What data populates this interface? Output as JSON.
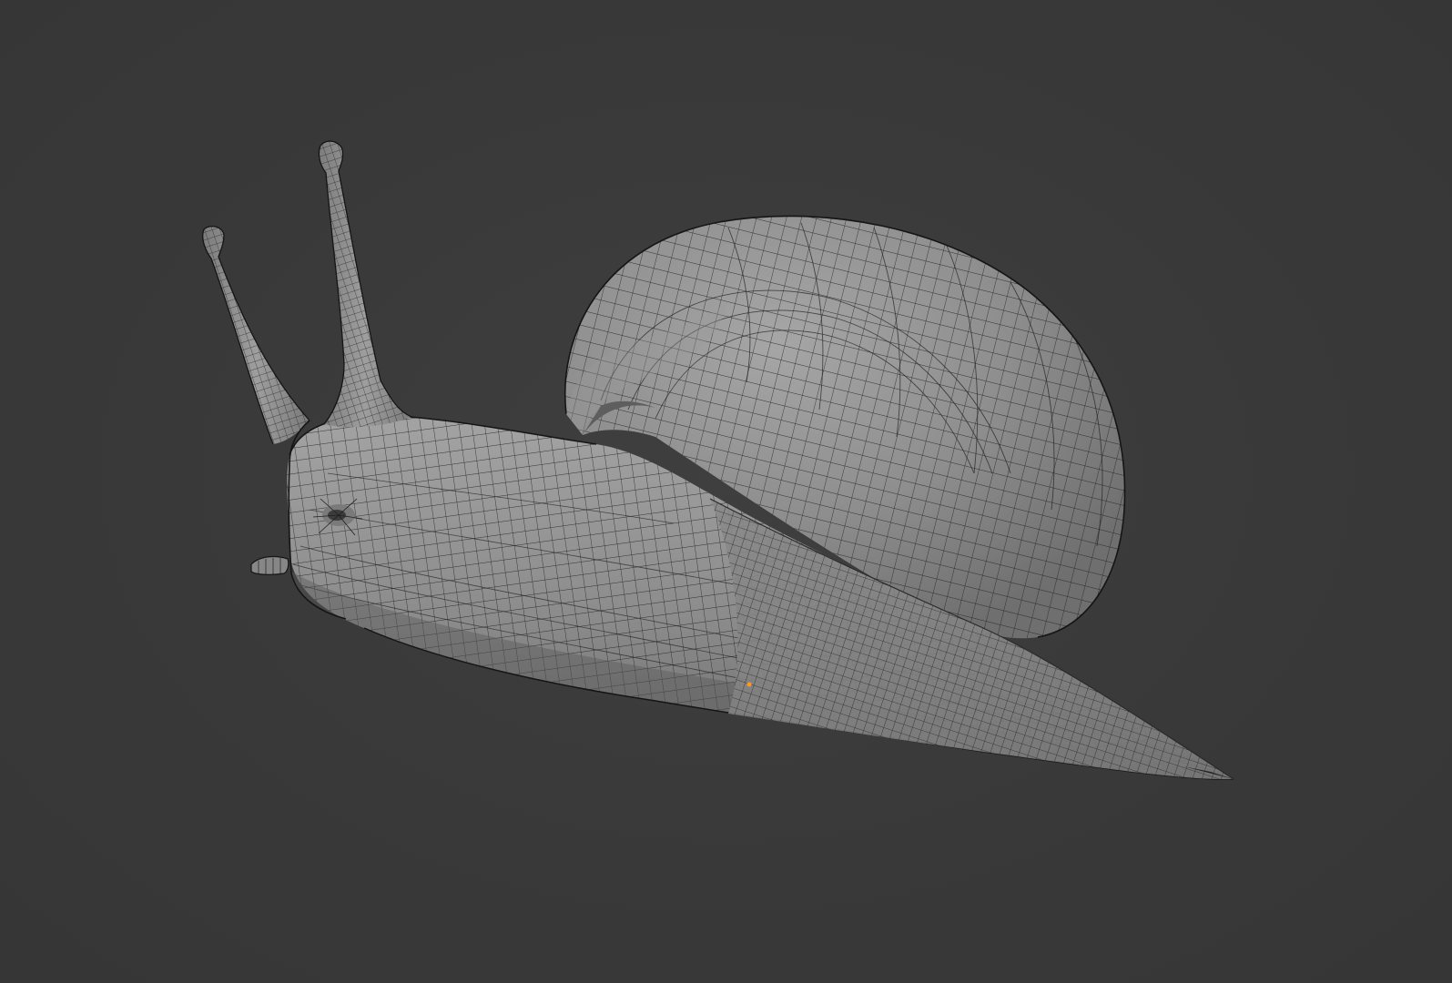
{
  "viewport": {
    "background_color": "#393939",
    "object": {
      "name": "snail-mesh",
      "display": "solid-with-wireframe",
      "surface_color": "#8f8f8f",
      "wire_color": "#1c1c1c"
    },
    "origin_marker_color": "#ff9a1f"
  }
}
